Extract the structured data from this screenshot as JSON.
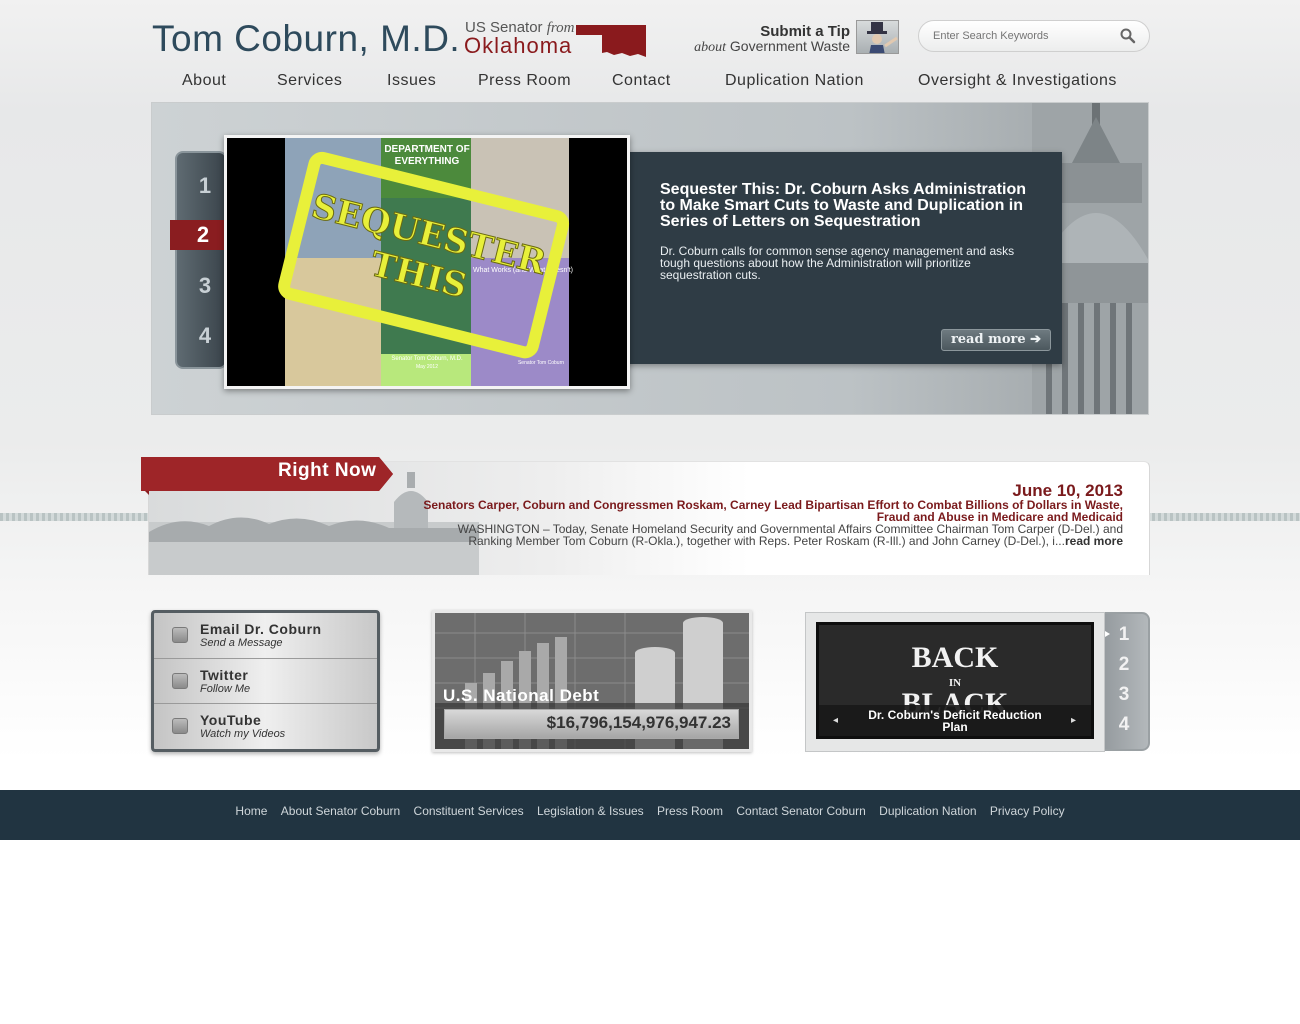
{
  "header": {
    "senator_name": "Tom Coburn, M.D.",
    "title_prefix": "US Senator",
    "title_from": "from",
    "state": "Oklahoma",
    "tip_title": "Submit a Tip",
    "tip_about": "about",
    "tip_subject": "Government Waste",
    "search_placeholder": "Enter Search Keywords"
  },
  "nav": [
    {
      "label": "About"
    },
    {
      "label": "Services"
    },
    {
      "label": "Issues"
    },
    {
      "label": "Press Room"
    },
    {
      "label": "Contact"
    },
    {
      "label": "Duplication Nation"
    },
    {
      "label": "Oversight & Investigations"
    }
  ],
  "slider": {
    "numbers": [
      "1",
      "2",
      "3",
      "4"
    ],
    "active": "2",
    "title": "Sequester This: Dr. Coburn Asks Administration to Make Smart Cuts to Waste and Duplication in Series of Letters on Sequestration",
    "text": "Dr. Coburn calls for common sense agency management and asks tough questions about how the Administration will prioritize sequestration cuts.",
    "read_more": "read more ➔",
    "image": {
      "dept_line1": "DEPARTMENT OF",
      "dept_line2": "EVERYTHING",
      "stamp_line1": "SEQUESTER",
      "stamp_line2": "THIS",
      "what_works": "What Works (and What Doesn't)",
      "caption_author": "Senator Tom Coburn, M.D.",
      "caption_date": "May 2012",
      "corner_label": "Senator Tom Coburn"
    }
  },
  "right_now": {
    "label": "Right Now",
    "date": "June 10, 2013",
    "headline": "Senators Carper, Coburn and Congressmen Roskam, Carney Lead Bipartisan Effort to Combat Billions of Dollars in Waste, Fraud and Abuse in Medicare and Medicaid",
    "body": "WASHINGTON – Today, Senate Homeland Security and Governmental Affairs Committee Chairman Tom Carper (D-Del.) and Ranking Member Tom Coburn (R-Okla.), together with Reps. Peter Roskam (R-Ill.) and John Carney (D-Del.), i...",
    "read_more": "read more"
  },
  "social": [
    {
      "title": "Email Dr. Coburn",
      "subtitle": "Send a Message",
      "icon": "envelope-icon"
    },
    {
      "title": "Twitter",
      "subtitle": "Follow Me",
      "icon": "twitter-icon"
    },
    {
      "title": "YouTube",
      "subtitle": "Watch my Videos",
      "icon": "youtube-icon"
    }
  ],
  "debt": {
    "label": "U.S. National Debt",
    "value": "$16,796,154,976,947.23"
  },
  "feature": {
    "numbers": [
      "1",
      "2",
      "3",
      "4"
    ],
    "image_line1": "BACK",
    "image_line2": "IN",
    "image_line3": "BLACK",
    "caption": "Dr. Coburn's Deficit Reduction Plan",
    "prev_arrow": "◂",
    "next_arrow": "▸"
  },
  "footer": [
    {
      "label": "Home"
    },
    {
      "label": "About Senator Coburn"
    },
    {
      "label": "Constituent Services"
    },
    {
      "label": "Legislation & Issues"
    },
    {
      "label": "Press Room"
    },
    {
      "label": "Contact Senator Coburn"
    },
    {
      "label": "Duplication Nation"
    },
    {
      "label": "Privacy Policy"
    }
  ],
  "colors": {
    "brand_blue": "#2e4a5c",
    "accent_red": "#8a1a1d",
    "footer_bg": "#213441",
    "caption_bg": "#2f3c45"
  }
}
